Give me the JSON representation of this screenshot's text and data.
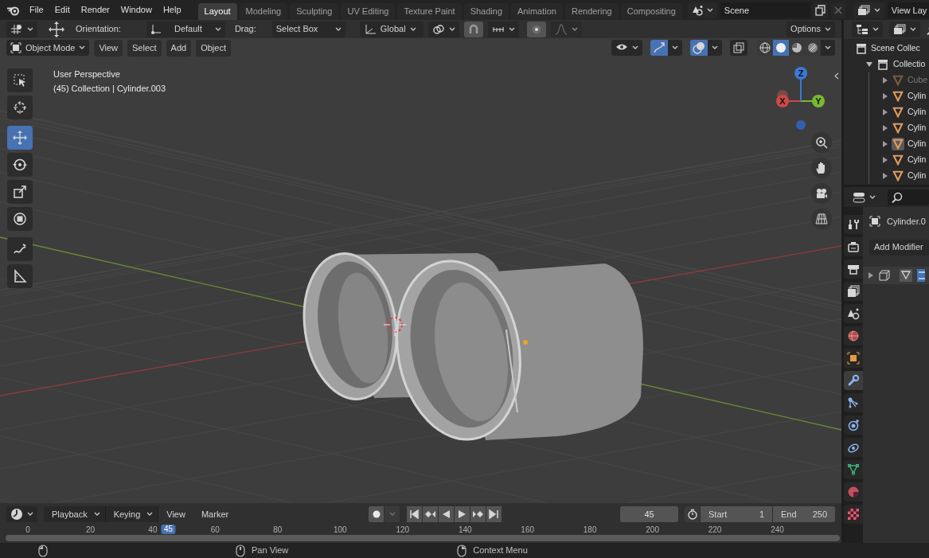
{
  "menu": [
    "File",
    "Edit",
    "Render",
    "Window",
    "Help"
  ],
  "workspace_tabs": [
    {
      "label": "Layout",
      "selected": true
    },
    {
      "label": "Modeling",
      "selected": false
    },
    {
      "label": "Sculpting",
      "selected": false
    },
    {
      "label": "UV Editing",
      "selected": false
    },
    {
      "label": "Texture Paint",
      "selected": false
    },
    {
      "label": "Shading",
      "selected": false
    },
    {
      "label": "Animation",
      "selected": false
    },
    {
      "label": "Rendering",
      "selected": false
    },
    {
      "label": "Compositing",
      "selected": false
    }
  ],
  "scene": {
    "name": "Scene"
  },
  "view_layer": {
    "name": "View Lay"
  },
  "tool_header": {
    "orientation_label": "Orientation:",
    "orientation": "Default",
    "drag_label": "Drag:",
    "drag": "Select Box",
    "transform_orientation": "Global",
    "options": "Options"
  },
  "viewport_header": {
    "mode": "Object Mode",
    "menus": [
      "View",
      "Select",
      "Add",
      "Object"
    ],
    "gizmos_on": true,
    "overlays_on": true,
    "xray_on": false,
    "shading": [
      {
        "kind": "wireframe",
        "selected": false
      },
      {
        "kind": "solid",
        "selected": true
      },
      {
        "kind": "material",
        "selected": false
      },
      {
        "kind": "rendered",
        "selected": false
      }
    ]
  },
  "viewport": {
    "perspective": "User Perspective",
    "context": "(45) Collection | Cylinder.003",
    "axes": [
      {
        "kind": "x",
        "label": "X"
      },
      {
        "kind": "y",
        "label": "Y"
      },
      {
        "kind": "z",
        "label": "Z"
      }
    ]
  },
  "toolbar": [
    {
      "tools": [
        {
          "kind": "select_box",
          "selected": false
        },
        {
          "kind": "cursor",
          "selected": false
        }
      ]
    },
    {
      "tools": [
        {
          "kind": "move",
          "selected": true
        },
        {
          "kind": "rotate",
          "selected": false
        },
        {
          "kind": "scale",
          "selected": false
        },
        {
          "kind": "transform",
          "selected": false
        }
      ]
    },
    {
      "tools": [
        {
          "kind": "annotate",
          "selected": false
        },
        {
          "kind": "measure",
          "selected": false
        }
      ]
    }
  ],
  "outliner": {
    "tree": [
      {
        "name": "Scene Collec",
        "kind": "scene_collection",
        "children": [
          {
            "name": "Collectio",
            "kind": "collection",
            "expanded": true,
            "children": [
              {
                "name": "Cube",
                "kind": "mesh",
                "expanded": false,
                "hidden": true,
                "active": false
              },
              {
                "name": "Cylin",
                "kind": "mesh",
                "expanded": false,
                "hidden": false,
                "active": false
              },
              {
                "name": "Cylin",
                "kind": "mesh",
                "expanded": false,
                "hidden": false,
                "active": false
              },
              {
                "name": "Cylin",
                "kind": "mesh",
                "expanded": false,
                "hidden": false,
                "active": false
              },
              {
                "name": "Cylin",
                "kind": "mesh",
                "expanded": false,
                "hidden": false,
                "active": true
              },
              {
                "name": "Cylin",
                "kind": "mesh",
                "expanded": false,
                "hidden": false,
                "active": false
              },
              {
                "name": "Cylin",
                "kind": "mesh",
                "expanded": false,
                "hidden": false,
                "active": false
              }
            ]
          }
        ]
      }
    ]
  },
  "properties": {
    "tabs": [
      {
        "kind": "tool",
        "selected": false
      },
      {
        "kind": "render",
        "selected": false
      },
      {
        "kind": "output",
        "selected": false
      },
      {
        "kind": "view_layer",
        "selected": false
      },
      {
        "kind": "scene",
        "selected": false
      },
      {
        "kind": "world",
        "selected": false
      },
      {
        "kind": "object",
        "selected": false
      },
      {
        "kind": "modifier",
        "selected": true
      },
      {
        "kind": "particles",
        "selected": false
      },
      {
        "kind": "physics",
        "selected": false
      },
      {
        "kind": "constraints",
        "selected": false
      },
      {
        "kind": "data",
        "selected": false
      },
      {
        "kind": "material",
        "selected": false
      },
      {
        "kind": "texture",
        "selected": false
      }
    ],
    "object_name": "Cylinder.0",
    "add_modifier": "Add Modifier",
    "modifier": {
      "expanded": false
    }
  },
  "timeline": {
    "menus": [
      {
        "label": "Playback",
        "kind": "dropdown"
      },
      {
        "label": "Keying",
        "kind": "dropdown"
      },
      {
        "label": "View",
        "kind": "menu"
      },
      {
        "label": "Marker",
        "kind": "menu"
      }
    ],
    "auto_keying": {
      "on": false
    },
    "current_frame": "45",
    "preview_range": {
      "on": false
    },
    "start_label": "Start",
    "start": "1",
    "end_label": "End",
    "end": "250",
    "ruler": {
      "ticks": [
        "0",
        "20",
        "40",
        "60",
        "80",
        "100",
        "120",
        "140",
        "160",
        "180",
        "200",
        "220",
        "240"
      ],
      "playhead": {
        "label": "45",
        "level": 0.173
      }
    }
  },
  "status_bar": [
    {
      "kind": "mouse_left"
    },
    {
      "kind": "mouse_middle",
      "label": "Pan View"
    },
    {
      "kind": "mouse_right",
      "label": "Context Menu"
    }
  ]
}
